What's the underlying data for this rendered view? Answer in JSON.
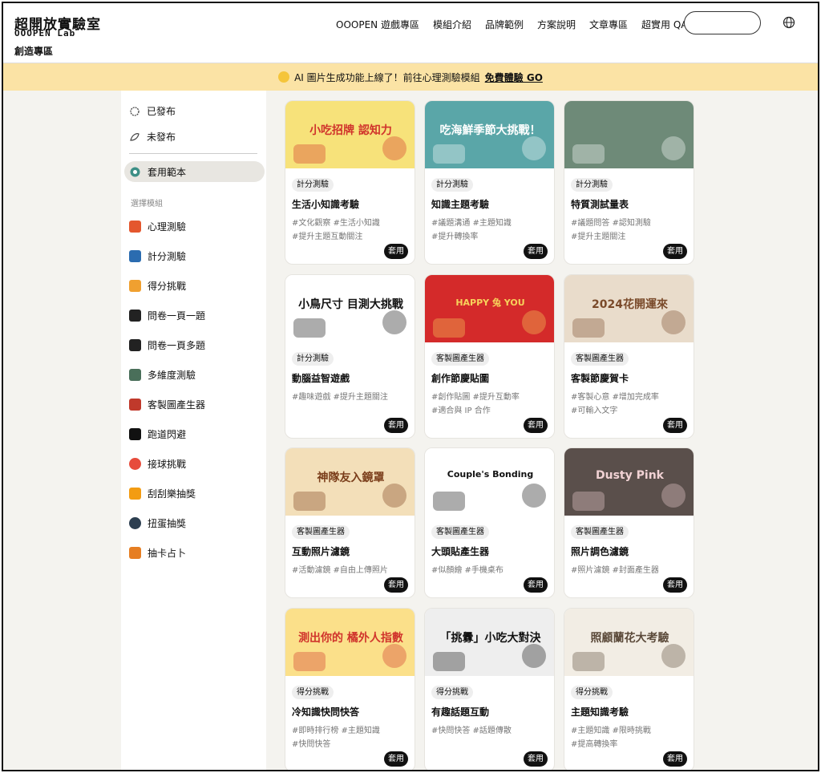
{
  "logo": {
    "title_cn": "超開放實驗室",
    "title_en": "OOOPEN Lab",
    "subtitle": "創造專區"
  },
  "nav": [
    "OOOPEN 遊戲專區",
    "模組介紹",
    "品牌範例",
    "方案說明",
    "文章專區",
    "超實用 QA"
  ],
  "search": {
    "placeholder": ""
  },
  "announce": {
    "text": "AI 圖片生成功能上線了！前往心理測驗模組",
    "link": "免費體驗 GO"
  },
  "sidebar": {
    "published": "已發布",
    "unpublished": "未發布",
    "templates": "套用範本",
    "select_label": "選擇模組",
    "modules": [
      "心理測驗",
      "計分測驗",
      "得分挑戰",
      "問卷一頁一題",
      "問卷一頁多題",
      "多維度測驗",
      "客製圖產生器",
      "跑道閃避",
      "接球挑戰",
      "刮刮樂抽獎",
      "扭蛋抽獎",
      "抽卡占卜"
    ]
  },
  "apply_label": "套用",
  "cards": [
    {
      "tag": "計分測驗",
      "title": "生活小知識考驗",
      "hash1": "#文化觀察  #生活小知識",
      "hash2": "#提升主題互動關注",
      "thumb": "小吃招牌 認知力",
      "bg": "#f7e27a",
      "fg": "#d0342c"
    },
    {
      "tag": "計分測驗",
      "title": "知識主題考驗",
      "hash1": "#議題溝通  #主題知識",
      "hash2": "#提升轉換率",
      "thumb": "吃海鮮季節大挑戰！",
      "bg": "#5aa6a8",
      "fg": "#fff"
    },
    {
      "tag": "計分測驗",
      "title": "特質測試量表",
      "hash1": "#議題問答  #認知測驗",
      "hash2": "#提升主題關注",
      "thumb": "",
      "bg": "#6e8a78",
      "fg": "#fff"
    },
    {
      "tag": "計分測驗",
      "title": "動腦益智遊戲",
      "hash1": "#趣味遊戲  #提升主題關注",
      "hash2": "",
      "thumb": "小鳥尺寸 目測大挑戰",
      "bg": "#ffffff",
      "fg": "#111"
    },
    {
      "tag": "客製圖產生器",
      "title": "創作節慶貼圖",
      "hash1": "#創作貼圖  #提升互動率",
      "hash2": "#適合與 IP 合作",
      "thumb": "HAPPY 兔 YOU",
      "bg": "#d42a2a",
      "fg": "#f7d25b"
    },
    {
      "tag": "客製圖產生器",
      "title": "客製節慶賀卡",
      "hash1": "#客製心意  #增加完成率",
      "hash2": "#可輸入文字",
      "thumb": "2024花開運來",
      "bg": "#e9dccb",
      "fg": "#7a4a2a"
    },
    {
      "tag": "客製圖產生器",
      "title": "互動照片濾鏡",
      "hash1": "#活動濾鏡  #自由上傳照片",
      "hash2": "",
      "thumb": "神隊友入鏡罩",
      "bg": "#f3dfb9",
      "fg": "#7a3d1a"
    },
    {
      "tag": "客製圖產生器",
      "title": "大頭貼產生器",
      "hash1": "#似顏繪  #手機桌布",
      "hash2": "",
      "thumb": "Couple's Bonding",
      "bg": "#ffffff",
      "fg": "#111"
    },
    {
      "tag": "客製圖產生器",
      "title": "照片調色濾鏡",
      "hash1": "#照片濾鏡  #封面產生器",
      "hash2": "",
      "thumb": "Dusty Pink",
      "bg": "#5a4f4b",
      "fg": "#f1d2d4"
    },
    {
      "tag": "得分挑戰",
      "title": "冷知識快問快答",
      "hash1": "#即時排行榜  #主題知識",
      "hash2": "#快問快答",
      "thumb": "測出你的 橘外人指數",
      "bg": "#fbe08a",
      "fg": "#d0342c"
    },
    {
      "tag": "得分挑戰",
      "title": "有趣話題互動",
      "hash1": "#快問快答  #話題傳散",
      "hash2": "",
      "thumb": "「挑釁」小吃大對決",
      "bg": "#eeeeee",
      "fg": "#111"
    },
    {
      "tag": "得分挑戰",
      "title": "主題知識考驗",
      "hash1": "#主題知識  #限時挑戰",
      "hash2": "#提高轉換率",
      "thumb": "照顧蘭花大考驗",
      "bg": "#f2ede4",
      "fg": "#5b4a3a"
    }
  ]
}
